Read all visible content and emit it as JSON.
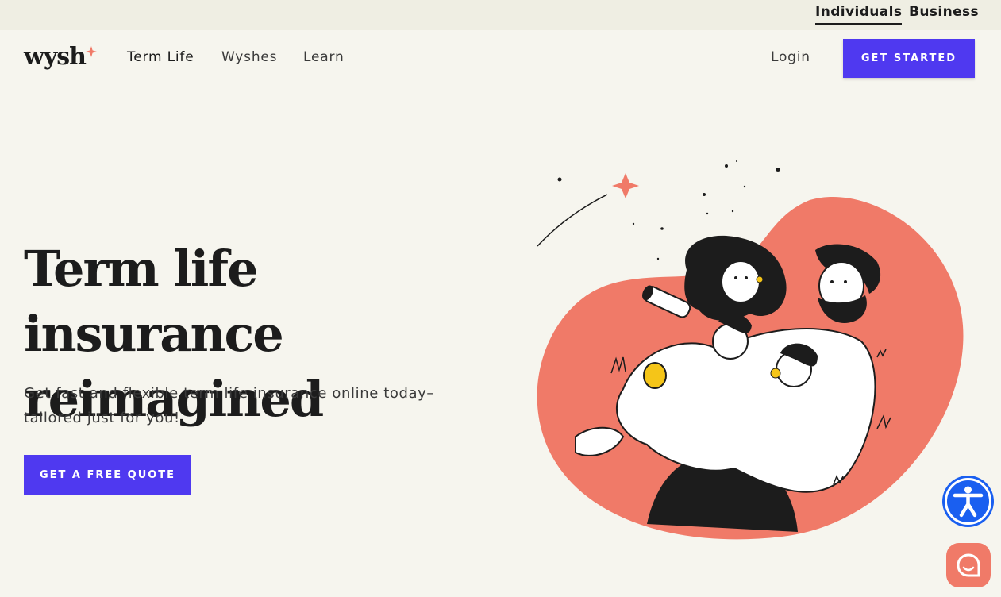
{
  "topbar": {
    "individuals": "Individuals",
    "business": "Business"
  },
  "nav": {
    "logo": "wysh",
    "links": [
      "Term Life",
      "Wyshes",
      "Learn"
    ],
    "login": "Login",
    "cta": "GET STARTED"
  },
  "hero": {
    "title_line1": "Term life insurance",
    "title_line2": "reimagined",
    "subtitle_line1": "Get fast and flexible term life insurance online today–",
    "subtitle_line2": "tailored just for you!",
    "cta": "GET A FREE QUOTE"
  },
  "icons": {
    "logo_spark": "sparkle-icon",
    "accessibility": "accessibility-icon",
    "chat": "chat-icon"
  },
  "colors": {
    "accent": "#4f39f0",
    "coral": "#f07a68",
    "background": "#f6f5ee",
    "accessibility_blue": "#1a5ff0"
  }
}
